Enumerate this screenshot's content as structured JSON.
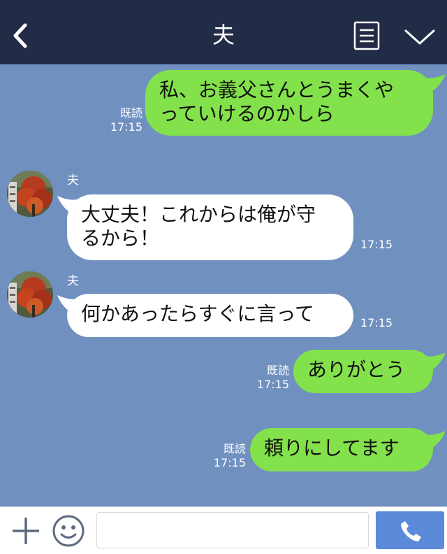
{
  "header": {
    "title": "夫",
    "back_icon": "chevron-left-icon",
    "menu_icon": "menu-icon",
    "collapse_icon": "chevron-down-icon"
  },
  "messages": [
    {
      "type": "out",
      "lines": [
        "私、お義父さんとうまくや",
        "っていけるのかしら"
      ],
      "read": "既読",
      "time": "17:15"
    },
    {
      "type": "in",
      "sender": "夫",
      "lines": [
        "大丈夫！これからは俺が守",
        "るから！"
      ],
      "time": "17:15"
    },
    {
      "type": "in",
      "sender": "夫",
      "lines": [
        "何かあったらすぐに言って"
      ],
      "time": "17:15"
    },
    {
      "type": "out",
      "lines": [
        "ありがとう"
      ],
      "read": "既読",
      "time": "17:15"
    },
    {
      "type": "out",
      "lines": [
        "頼りにしてます"
      ],
      "read": "既読",
      "time": "17:15"
    }
  ],
  "input": {
    "value": "",
    "placeholder": ""
  },
  "colors": {
    "header_bg": "#232c46",
    "chat_bg": "#7090c0",
    "outgoing_bubble": "#83e14c",
    "incoming_bubble": "#ffffff",
    "call_button": "#5a8ad9"
  },
  "icons": {
    "plus": "plus-icon",
    "emoji": "smiley-icon",
    "call": "phone-icon"
  }
}
